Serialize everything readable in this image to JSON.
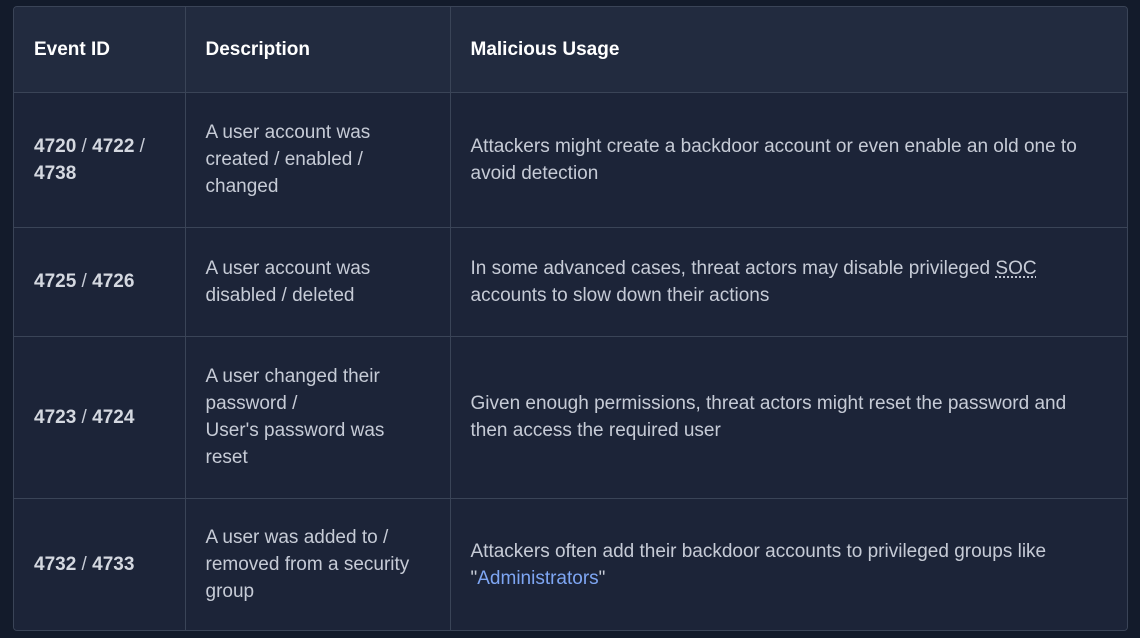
{
  "headers": {
    "event_id": "Event ID",
    "description": "Description",
    "malicious_usage": "Malicious Usage"
  },
  "rows": [
    {
      "ids": [
        "4720",
        "4722",
        "4738"
      ],
      "separator": " / ",
      "description_lines": [
        "A user account was",
        "created / enabled /",
        "changed"
      ],
      "usage_text": "Attackers might create a backdoor account or even enable an old one to avoid detection"
    },
    {
      "ids": [
        "4725",
        "4726"
      ],
      "separator": " / ",
      "description_lines": [
        "A user account was",
        "disabled / deleted"
      ],
      "usage_prefix": "In some advanced cases, threat actors may disable privileged ",
      "usage_abbr": "SOC",
      "usage_suffix": " accounts to slow down their actions"
    },
    {
      "ids": [
        "4723",
        "4724"
      ],
      "separator": " / ",
      "description_lines": [
        "A user changed their",
        "password /",
        "User's password was",
        "reset"
      ],
      "usage_text": "Given enough permissions, threat actors might reset the password and then access the required user"
    },
    {
      "ids": [
        "4732",
        "4733"
      ],
      "separator": " / ",
      "description_lines": [
        "A user was added to /",
        "removed from a security",
        "group"
      ],
      "usage_prefix": "Attackers often add their backdoor accounts to privileged groups like \"",
      "usage_link": "Administrators",
      "usage_suffix": "\""
    }
  ],
  "colors": {
    "background": "#131b2b",
    "cell": "#1c2438",
    "header": "#222b3f",
    "border": "#3a4457",
    "text": "#c6cbd6",
    "link": "#7ea6f3"
  }
}
